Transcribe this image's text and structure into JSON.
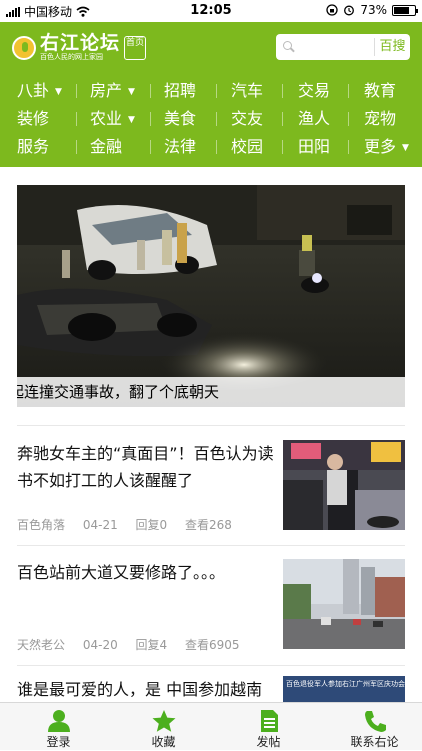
{
  "status_bar": {
    "carrier": "中国移动",
    "time": "12:05",
    "battery": "73%",
    "battery_level": 0.73
  },
  "header": {
    "logo_title": "右江论坛",
    "logo_subtitle": "百色人民的网上家园",
    "logo_tag": "首页",
    "search_placeholder": "",
    "search_button": "百搜",
    "accent_color": "#7db91e"
  },
  "categories": [
    {
      "label": "八卦",
      "caret": true
    },
    {
      "label": "房产",
      "caret": true
    },
    {
      "label": "招聘",
      "caret": false
    },
    {
      "label": "汽车",
      "caret": false
    },
    {
      "label": "交易",
      "caret": false
    },
    {
      "label": "教育",
      "caret": false
    },
    {
      "label": "装修",
      "caret": false
    },
    {
      "label": "农业",
      "caret": true
    },
    {
      "label": "美食",
      "caret": false
    },
    {
      "label": "交友",
      "caret": false
    },
    {
      "label": "渔人",
      "caret": false
    },
    {
      "label": "宠物",
      "caret": false
    },
    {
      "label": "服务",
      "caret": false
    },
    {
      "label": "金融",
      "caret": false
    },
    {
      "label": "法律",
      "caret": false
    },
    {
      "label": "校园",
      "caret": false
    },
    {
      "label": "田阳",
      "caret": false
    },
    {
      "label": "更多",
      "caret": true
    }
  ],
  "hero": {
    "caption": "起连撞交通事故，翻了个底朝天"
  },
  "posts": [
    {
      "title": "奔驰女车主的“真面目”！百色认为读书不如打工的人该醒醒了",
      "author": "百色角落",
      "date": "04-21",
      "replies": "回复0",
      "views": "查看268"
    },
    {
      "title": "百色站前大道又要修路了。。。",
      "author": "天然老公",
      "date": "04-20",
      "replies": "回复4",
      "views": "查看6905"
    },
    {
      "title": "谁是最可爱的人，是 中国参加越南",
      "thumb_text": "百色退役军人参加右江广州军区庆功会"
    }
  ],
  "tabbar": {
    "tabs": [
      {
        "label": "登录",
        "icon": "user-icon"
      },
      {
        "label": "收藏",
        "icon": "star-icon"
      },
      {
        "label": "发帖",
        "icon": "document-icon"
      },
      {
        "label": "联系右论",
        "icon": "phone-icon"
      }
    ]
  }
}
